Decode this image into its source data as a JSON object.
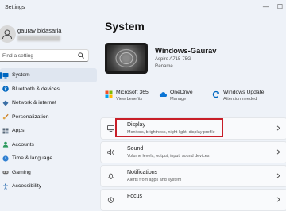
{
  "window": {
    "title": "Settings"
  },
  "profile": {
    "name": "gaurav bidasaria",
    "email": ""
  },
  "search": {
    "placeholder": "Find a setting"
  },
  "nav": [
    {
      "label": "System",
      "icon": "system-icon",
      "color": "#0067c0"
    },
    {
      "label": "Bluetooth & devices",
      "icon": "bluetooth-icon",
      "color": "#0067c0"
    },
    {
      "label": "Network & internet",
      "icon": "network-icon",
      "color": "#3a6ea5"
    },
    {
      "label": "Personalization",
      "icon": "brush-icon",
      "color": "#c77d2a"
    },
    {
      "label": "Apps",
      "icon": "apps-icon",
      "color": "#5a6a7a"
    },
    {
      "label": "Accounts",
      "icon": "accounts-icon",
      "color": "#2e9b5f"
    },
    {
      "label": "Time & language",
      "icon": "clock-icon",
      "color": "#2f7fd1"
    },
    {
      "label": "Gaming",
      "icon": "gaming-icon",
      "color": "#6b6b6b"
    },
    {
      "label": "Accessibility",
      "icon": "accessibility-icon",
      "color": "#2b6cb0"
    }
  ],
  "main": {
    "title": "System",
    "device": {
      "name": "Windows-Gaurav",
      "model": "Aspire A715-75G",
      "rename": "Rename"
    },
    "status": [
      {
        "name": "Microsoft 365",
        "sub": "View benefits",
        "icon": "microsoft365-icon"
      },
      {
        "name": "OneDrive",
        "sub": "Manage",
        "icon": "onedrive-icon"
      },
      {
        "name": "Windows Update",
        "sub": "Attention needed",
        "icon": "windows-update-icon"
      }
    ],
    "cards": [
      {
        "title": "Display",
        "sub": "Monitors, brightness, night light, display profile",
        "icon": "display-icon"
      },
      {
        "title": "Sound",
        "sub": "Volume levels, output, input, sound devices",
        "icon": "sound-icon"
      },
      {
        "title": "Notifications",
        "sub": "Alerts from apps and system",
        "icon": "bell-icon"
      },
      {
        "title": "Focus",
        "sub": "",
        "icon": "focus-icon"
      }
    ]
  },
  "colors": {
    "accent": "#0067c0",
    "highlight": "#c81e28"
  }
}
